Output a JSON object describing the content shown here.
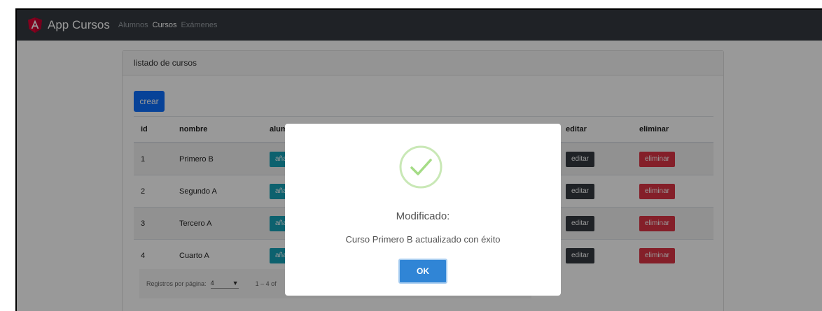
{
  "navbar": {
    "brand": "App Cursos",
    "links": [
      "Alumnos",
      "Cursos",
      "Exámenes"
    ],
    "active_link": "Cursos"
  },
  "card": {
    "header": "listado de cursos",
    "create_label": "crear"
  },
  "table": {
    "columns": [
      "id",
      "nombre",
      "alumnos",
      "",
      "editar",
      "eliminar"
    ],
    "rows": [
      {
        "id": "1",
        "nombre": "Primero B"
      },
      {
        "id": "2",
        "nombre": "Segundo A"
      },
      {
        "id": "3",
        "nombre": "Tercero A"
      },
      {
        "id": "4",
        "nombre": "Cuarto A"
      }
    ],
    "row_buttons": {
      "alumnos": "añadir",
      "editar": "editar",
      "eliminar": "eliminar"
    }
  },
  "paginator": {
    "page_size_label": "Registros por página:",
    "page_size": "4",
    "range_label": "1 – 4 of"
  },
  "dialog": {
    "title": "Modificado:",
    "text": "Curso Primero B actualizado con éxito",
    "ok_label": "OK"
  },
  "colors": {
    "navbar": "#343a40",
    "primary": "#0d6efd",
    "info": "#17a2b8",
    "danger": "#dc3545",
    "dialog_ok": "#3085d6",
    "success": "#a5dc86"
  }
}
